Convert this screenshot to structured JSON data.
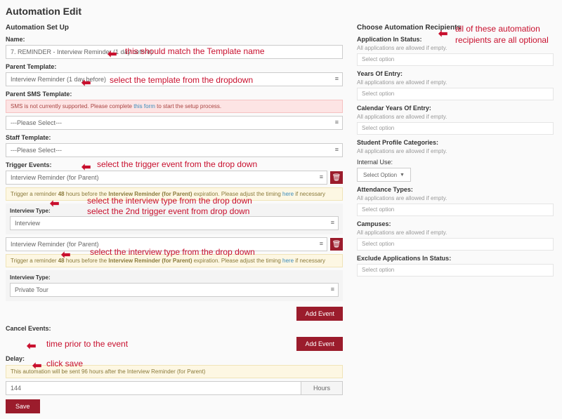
{
  "page_title": "Automation Edit",
  "left": {
    "section_title": "Automation Set Up",
    "name_label": "Name:",
    "name_value": "7. REMINDER - Interview Reminder (1 day before)",
    "parent_template_label": "Parent Template:",
    "parent_template_value": "Interview Reminder (1 day before)",
    "sms_label": "Parent SMS Template:",
    "sms_warning_a": "SMS is not currently supported. Please complete ",
    "sms_warning_link": "this form",
    "sms_warning_b": " to start the setup process.",
    "sms_value": "---Please Select---",
    "staff_label": "Staff Template:",
    "staff_value": "---Please Select---",
    "trigger_label": "Trigger Events:",
    "trigger1_value": "Interview Reminder (for Parent)",
    "trigger_msg_a": "Trigger a reminder ",
    "trigger_msg_b": "48",
    "trigger_msg_c": " hours before the ",
    "trigger_msg_d": "Interview Reminder (for Parent)",
    "trigger_msg_e": " expiration. Please adjust the timing ",
    "trigger_msg_link": "here",
    "trigger_msg_f": " if necessary",
    "interview_type_label": "Interview Type:",
    "interview_type1_value": "Interview",
    "trigger2_value": "Interview Reminder (for Parent)",
    "interview_type2_value": "Private Tour",
    "add_event_label": "Add Event",
    "cancel_label": "Cancel Events:",
    "delay_label": "Delay:",
    "delay_info": "This automation will be sent 96 hours after the Interview Reminder (for Parent)",
    "delay_value": "144",
    "delay_unit": "Hours",
    "save_label": "Save"
  },
  "right": {
    "title": "Choose Automation Recipients",
    "app_status_label": "Application In Status:",
    "helper": "All applications are allowed if empty.",
    "select_option": "Select option",
    "years_label": "Years Of Entry:",
    "cal_years_label": "Calendar Years Of Entry:",
    "profile_cat_label": "Student Profile Categories:",
    "internal_label": "Internal Use:",
    "internal_value": "Select Option",
    "attendance_label": "Attendance Types:",
    "campuses_label": "Campuses:",
    "exclude_label": "Exclude Applications In Status:"
  },
  "annotations": {
    "name": "this should match the Template name",
    "template": "select the template from the dropdown",
    "trigger": "select the trigger event from the drop down",
    "interview1": "select the interview type from the drop down",
    "trigger2": "select the 2nd trigger event from drop down",
    "interview2": "select the interview type from the drop down",
    "delay": "time prior to the event",
    "save": "click save",
    "right": "all of these automation recipients are all optional"
  }
}
